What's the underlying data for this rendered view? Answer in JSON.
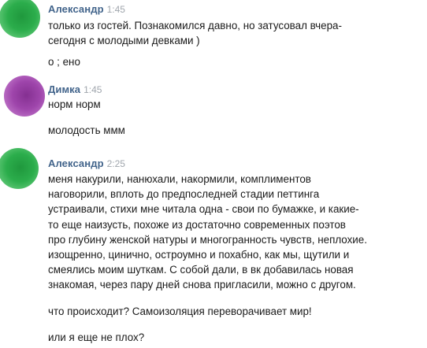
{
  "messages": [
    {
      "author": "Александр",
      "time": "1:45",
      "avatar_color": "#19a63c",
      "lines": [
        "только из гостей. Познакомился давно, но затусовал вчера-",
        "сегодня с молодыми девками )",
        "",
        "о ; ено"
      ]
    },
    {
      "author": "Димка",
      "time": "1:45",
      "avatar_color": "#9635a4",
      "lines": [
        "норм норм",
        "",
        "молодость ммм"
      ]
    },
    {
      "author": "Александр",
      "time": "2:25",
      "avatar_color": "#19a63c",
      "lines": [
        "меня накурили, нанюхали, накормили, комплиментов",
        "наговорили, вплоть до предпоследней стадии петтинга",
        "устраивали, стихи мне читала одна - свои по бумажке, и какие-",
        "то еще наизусть, похоже из достаточно современных поэтов",
        "про глубину женской натуры и многогранность чувств, неплохие.",
        "изощренно, цинично, остроумно и похабно, как мы, щутили и",
        "смеялись моим шуткам. С собой дали, в вк добавилась новая",
        "знакомая, через пару дней снова пригласили, можно с другом.",
        "",
        "что происходит? Самоизоляция переворачивает мир!",
        "",
        "или я еще не плох?"
      ]
    }
  ]
}
